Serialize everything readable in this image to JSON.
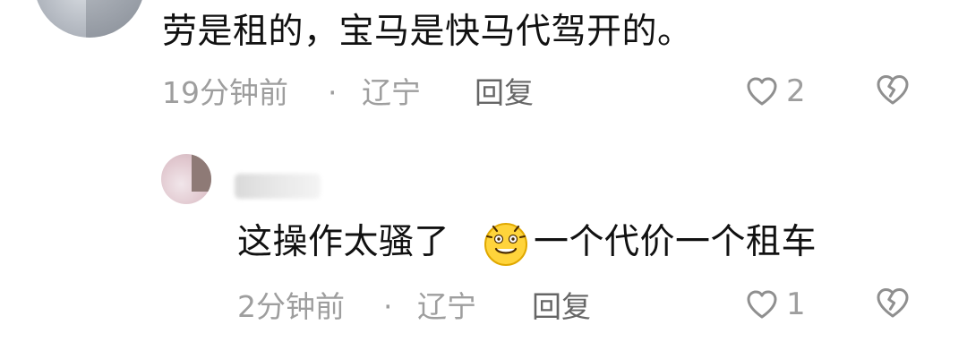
{
  "comment_main": {
    "text": "劳是租的，宝马是快马代驾开的。",
    "time": "19分钟前",
    "separator": "·",
    "location": "辽宁",
    "reply_label": "回复",
    "likes": "2",
    "like_icon": "heart-outline-icon",
    "dislike_icon": "broken-heart-icon"
  },
  "reply_comment": {
    "text_before_emoji": "这操作太骚了",
    "emoji": "flushed-laughing-emoji",
    "text_after_emoji": " 一个代价一个租车",
    "time": "2分钟前",
    "separator": "·",
    "location": "辽宁",
    "reply_label": "回复",
    "likes": "1",
    "like_icon": "heart-outline-icon",
    "dislike_icon": "broken-heart-icon"
  },
  "colors": {
    "text": "#111111",
    "meta": "#9e9e9e",
    "reply": "#666666",
    "background": "#ffffff"
  }
}
